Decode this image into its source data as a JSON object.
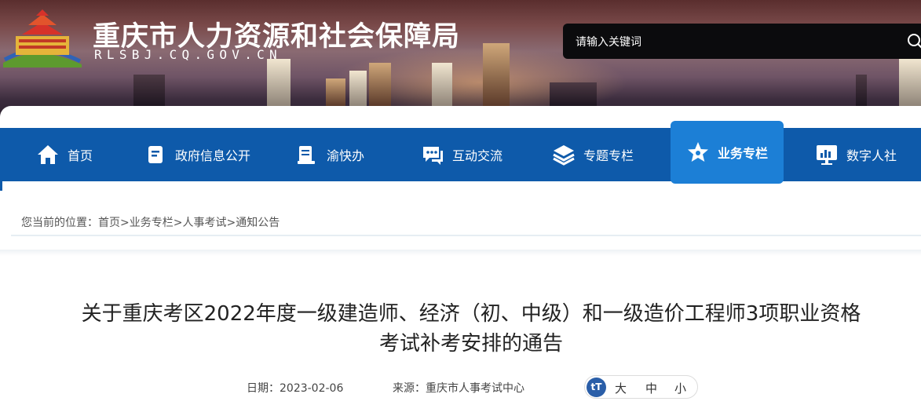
{
  "header": {
    "site_title": "重庆市人力资源和社会保障局",
    "site_domain": "RLSBJ.CQ.GOV.CN",
    "search_placeholder": "请输入关键词"
  },
  "nav": {
    "items": [
      {
        "label": "首页",
        "icon": "home-icon"
      },
      {
        "label": "政府信息公开",
        "icon": "document-icon"
      },
      {
        "label": "渝快办",
        "icon": "clipboard-icon"
      },
      {
        "label": "互动交流",
        "icon": "chat-icon"
      },
      {
        "label": "专题专栏",
        "icon": "layers-icon"
      },
      {
        "label": "业务专栏",
        "icon": "star-icon",
        "active": true
      },
      {
        "label": "数字人社",
        "icon": "monitor-icon"
      }
    ]
  },
  "breadcrumb": {
    "prefix": "您当前的位置：",
    "items": [
      "首页",
      "业务专栏",
      "人事考试",
      "通知公告"
    ],
    "separator": ">"
  },
  "article": {
    "title_line1": "关于重庆考区2022年度一级建造师、经济（初、中级）和一级造价工程师3项职业资格",
    "title_line2": "考试补考安排的通告",
    "date_label": "日期：",
    "date": "2023-02-06",
    "source_label": "来源：",
    "source": "重庆市人事考试中心",
    "font_size": {
      "icon_text": "tT",
      "large": "大",
      "medium": "中",
      "small": "小"
    }
  },
  "colors": {
    "nav_bg": "#0e5aaa",
    "nav_active": "#1c7fd6",
    "search_bg": "#0b0b0d"
  }
}
